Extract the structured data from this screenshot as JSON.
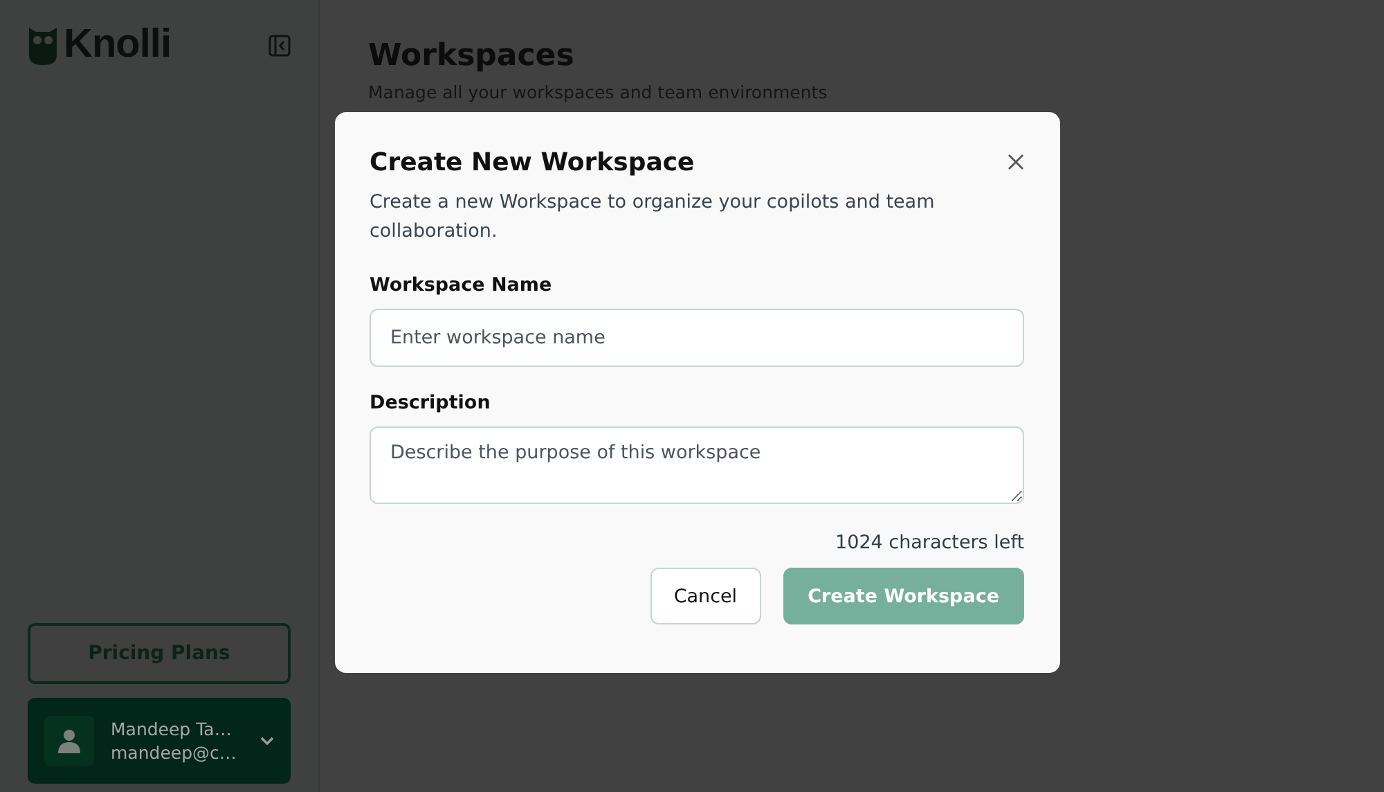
{
  "sidebar": {
    "logo": "Knolli",
    "pricing_button": "Pricing Plans",
    "user": {
      "name": "Mandeep Ta…",
      "email": "mandeep@c…"
    }
  },
  "page": {
    "title": "Workspaces",
    "subtitle": "Manage all your workspaces and team environments"
  },
  "dialog": {
    "title": "Create New Workspace",
    "description": "Create a new Workspace to organize your copilots and team collaboration.",
    "fields": [
      {
        "kind": "input",
        "label": "Workspace Name",
        "placeholder": "Enter workspace name"
      },
      {
        "kind": "textarea",
        "label": "Description",
        "placeholder": "Describe the purpose of this workspace"
      }
    ],
    "counter": "1024 characters left",
    "buttons": [
      {
        "kind": "secondary",
        "label": "Cancel"
      },
      {
        "kind": "primary",
        "label": "Create Workspace",
        "disabled": true
      }
    ]
  }
}
